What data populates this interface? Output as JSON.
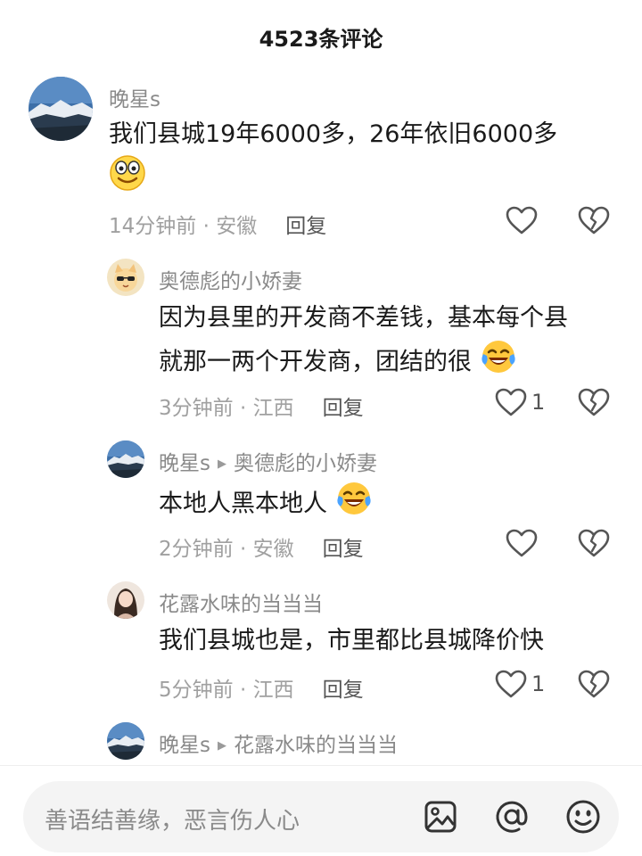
{
  "header": {
    "title": "4523条评论"
  },
  "comments": [
    {
      "user": "晚星s",
      "text": "我们县城19年6000多，26年依旧6000多",
      "emoji": "grin-emoji",
      "time": "14分钟前 · 安徽",
      "reply_label": "回复",
      "likes": ""
    },
    {
      "user": "奥德彪的小娇妻",
      "text_line1": "因为县里的开发商不差钱，基本每个县",
      "text_line2": "就那一两个开发商，团结的很",
      "emoji": "crying-laughing-emoji",
      "time": "3分钟前 · 江西",
      "reply_label": "回复",
      "likes": "1"
    },
    {
      "user": "晚星s",
      "reply_to": "奥德彪的小娇妻",
      "text": "本地人黑本地人",
      "emoji": "crying-laughing-emoji",
      "time": "2分钟前 · 安徽",
      "reply_label": "回复",
      "likes": ""
    },
    {
      "user": "花露水味的当当当",
      "text": "我们县城也是，市里都比县城降价快",
      "time": "5分钟前 · 江西",
      "reply_label": "回复",
      "likes": "1"
    },
    {
      "user": "晚星s",
      "reply_to": "花露水味的当当当"
    }
  ],
  "input_bar": {
    "placeholder": "善语结善缘，恶言伤人心",
    "icons": [
      "image-icon",
      "at-icon",
      "emoji-icon"
    ]
  },
  "colors": {
    "text": "#1a1a1a",
    "secondary": "#8a8a8a",
    "input_bg": "#f4f4f4"
  }
}
